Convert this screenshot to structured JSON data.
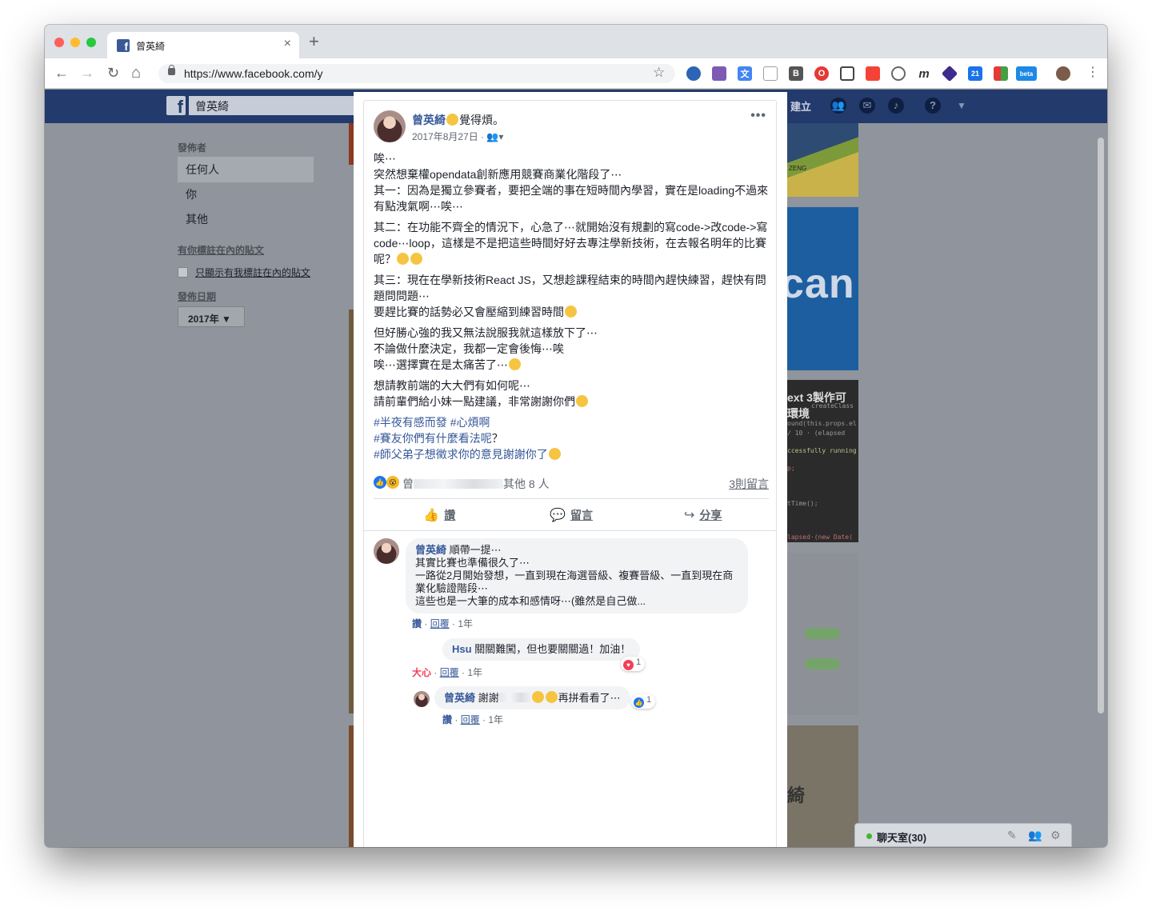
{
  "browser": {
    "tab_title": "曾英綺",
    "tab_close": "×",
    "new_tab": "+",
    "url": "https://www.facebook.com/y",
    "back": "←",
    "forward": "→",
    "reload": "↻",
    "home": "⌂",
    "star": "☆",
    "menu": "⋮",
    "extensions": [
      "extension-1",
      "extension-2",
      "translate-extension",
      "extension-4",
      "B",
      "opera-extension",
      "capture-extension",
      "extension-7",
      "extension-8",
      "m",
      "extension-10",
      "21",
      "extension-12",
      "beta",
      "extension-14"
    ]
  },
  "fb": {
    "search_value": "曾英綺",
    "create_label": "建立",
    "logo": "f"
  },
  "sidebar": {
    "posted_by": "發佈者",
    "options": [
      "任何人",
      "你",
      "其他"
    ],
    "tagged_title": "有你標註在內的貼文",
    "tagged_checkbox": "只顯示有我標註在內的貼文",
    "date_title": "發佈日期",
    "year_value": "2017年"
  },
  "background": {
    "tile_text_1": "ext 3製作可",
    "tile_text_2": "環境",
    "tile_code": [
      "createClass",
      "ound(this.props.el",
      "/ 10 · (elapsed",
      "ccessfully running",
      "p;",
      "tTime();",
      "lapsed·(new Date("
    ],
    "tile_big": "can",
    "tile_bottom": "綺",
    "tile_top": "ZENG"
  },
  "post": {
    "author": "曾英綺",
    "feeling": "覺得煩。",
    "date": "2017年8月27日",
    "more": "•••",
    "body": {
      "l1": "唉⋯",
      "l2": "突然想棄權opendata創新應用競賽商業化階段了⋯",
      "l3": "其一：因為是獨立參賽者，要把全端的事在短時間內學習，實在是loading不過來有點洩氣啊⋯唉⋯",
      "p2": "其二：在功能不齊全的情況下，心急了⋯就開始沒有規劃的寫code->改code->寫code⋯loop，這樣是不是把這些時間好好去專注學新技術，在去報名明年的比賽呢？",
      "p3a": "其三：現在在學新技術React JS，又想趁課程結束的時間內趕快練習，趕快有問題問問題⋯",
      "p3b": "要趕比賽的話勢必又會壓縮到練習時間",
      "p4a": "但好勝心強的我又無法說服我就這樣放下了⋯",
      "p4b": "不論做什麼決定，我都一定會後悔⋯唉",
      "p4c": "唉⋯選擇實在是太痛苦了⋯",
      "p5a": "想請教前端的大大們有如何呢⋯",
      "p5b": "請前輩們給小妹一點建議，非常謝謝你們",
      "tag1": "#半夜有感而發",
      "tag2": "#心煩啊",
      "tag3": "#賽友你們有什麼看法呢",
      "tag3_suffix": "？",
      "tag4": "#師父弟子想徵求你的意見謝謝你了"
    },
    "reactions": {
      "names_prefix": "曾",
      "others": "其他 8 人",
      "comment_count": "3則留言"
    },
    "actions": {
      "like": "讚",
      "comment": "留言",
      "share": "分享"
    }
  },
  "comments": [
    {
      "author": "曾英綺",
      "lines": [
        "順帶一提⋯",
        "其實比賽也準備很久了⋯",
        "一路從2月開始發想，一直到現在海選晉級、複賽晉級、一直到現在商業化驗證階段⋯",
        "這些也是一大筆的成本和感情呀⋯(雖然是自己做..."
      ],
      "like": "讚",
      "reply": "回覆",
      "time": "1年"
    },
    {
      "author": "Hsu",
      "text": "關關難闖，但也要關關過！加油！",
      "reaction": "大心",
      "reply": "回覆",
      "time": "1年",
      "badge_count": "1"
    },
    {
      "author": "曾英綺",
      "text_prefix": "謝謝",
      "text_suffix": "再拼看看了⋯",
      "like": "讚",
      "reply": "回覆",
      "time": "1年",
      "badge_count": "1"
    }
  ],
  "chat": {
    "label": "聊天室(30)"
  },
  "colors": {
    "fb_blue": "#3b5998",
    "link": "#365899",
    "dim_overlay": "#90949c"
  }
}
